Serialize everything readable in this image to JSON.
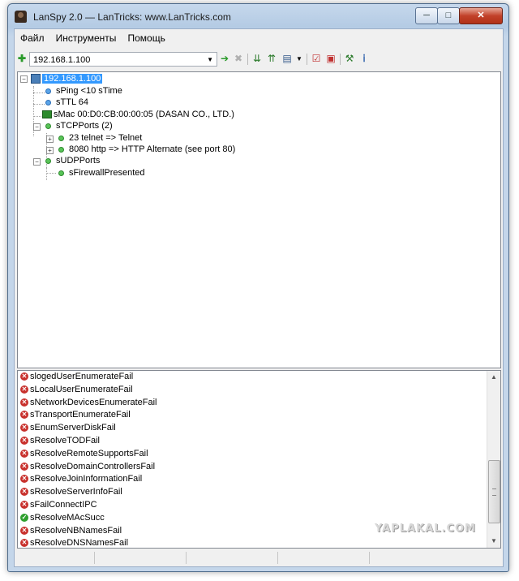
{
  "window": {
    "title": "LanSpy 2.0 — LanTricks: www.LanTricks.com",
    "min_glyph": "─",
    "max_glyph": "□",
    "close_glyph": "✕"
  },
  "menu": [
    "Файл",
    "Инструменты",
    "Помощь"
  ],
  "toolbar": {
    "address_value": "192.168.1.100",
    "icons": [
      "add-icon",
      "go-icon",
      "stop-icon",
      "import-icon",
      "export-icon",
      "options-icon",
      "dropdown-icon",
      "check-icon",
      "report-icon",
      "settings-icon",
      "info-icon"
    ]
  },
  "tree": {
    "root": "192.168.1.100",
    "ping": "sPing <10 sTime",
    "ttl": "sTTL 64",
    "mac": "sMac 00:D0:CB:00:00:05 (DASAN CO., LTD.)",
    "tcp_ports": "sTCPPorts (2)",
    "tcp_items": [
      "23 telnet => Telnet",
      "8080 http => HTTP Alternate (see port 80)"
    ],
    "udp_ports": "sUDPPorts",
    "firewall": "sFirewallPresented"
  },
  "log": [
    {
      "status": "error",
      "text": "slogedUserEnumerateFail"
    },
    {
      "status": "error",
      "text": "sLocalUserEnumerateFail"
    },
    {
      "status": "error",
      "text": "sNetworkDevicesEnumerateFail"
    },
    {
      "status": "error",
      "text": "sTransportEnumerateFail"
    },
    {
      "status": "error",
      "text": "sEnumServerDiskFail"
    },
    {
      "status": "error",
      "text": "sResolveTODFail"
    },
    {
      "status": "error",
      "text": "sResolveRemoteSupportsFail"
    },
    {
      "status": "error",
      "text": "sResolveDomainControllersFail"
    },
    {
      "status": "error",
      "text": "sResolveJoinInformationFail"
    },
    {
      "status": "error",
      "text": "sResolveServerInfoFail"
    },
    {
      "status": "error",
      "text": "sFailConnectIPC"
    },
    {
      "status": "success",
      "text": "sResolveMAcSucc"
    },
    {
      "status": "error",
      "text": "sResolveNBNamesFail"
    },
    {
      "status": "error",
      "text": "sResolveDNSNamesFail"
    }
  ],
  "watermark": "YAPLAKAL.COM",
  "colors": {
    "selection": "#3399ff",
    "error": "#c8302c",
    "success": "#2fa02f"
  }
}
